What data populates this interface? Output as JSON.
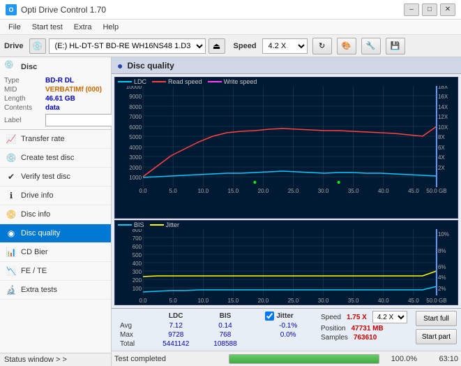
{
  "titleBar": {
    "title": "Opti Drive Control 1.70",
    "icon": "O",
    "minimizeLabel": "–",
    "maximizeLabel": "□",
    "closeLabel": "✕"
  },
  "menuBar": {
    "items": [
      "File",
      "Start test",
      "Extra",
      "Help"
    ]
  },
  "driveBar": {
    "driveLabel": "Drive",
    "driveValue": "(E:) HL-DT-ST BD-RE  WH16NS48 1.D3",
    "speedLabel": "Speed",
    "speedValue": "4.2 X"
  },
  "discSection": {
    "title": "Disc",
    "typeLabel": "Type",
    "typeValue": "BD-R DL",
    "midLabel": "MID",
    "midValue": "VERBATIMf (000)",
    "lengthLabel": "Length",
    "lengthValue": "46.61 GB",
    "contentsLabel": "Contents",
    "contentsValue": "data",
    "labelLabel": "Label"
  },
  "sidebarItems": [
    {
      "id": "transfer-rate",
      "label": "Transfer rate",
      "icon": "📈"
    },
    {
      "id": "create-test-disc",
      "label": "Create test disc",
      "icon": "💿"
    },
    {
      "id": "verify-test-disc",
      "label": "Verify test disc",
      "icon": "✅"
    },
    {
      "id": "drive-info",
      "label": "Drive info",
      "icon": "ℹ"
    },
    {
      "id": "disc-info",
      "label": "Disc info",
      "icon": "📀"
    },
    {
      "id": "disc-quality",
      "label": "Disc quality",
      "icon": "🔍",
      "active": true
    },
    {
      "id": "cd-bier",
      "label": "CD Bier",
      "icon": "📊"
    },
    {
      "id": "fe-te",
      "label": "FE / TE",
      "icon": "📉"
    },
    {
      "id": "extra-tests",
      "label": "Extra tests",
      "icon": "🔬"
    }
  ],
  "statusWindow": {
    "label": "Status window > >"
  },
  "discQuality": {
    "title": "Disc quality"
  },
  "topChart": {
    "legend": [
      {
        "label": "LDC",
        "color": "#00ccff"
      },
      {
        "label": "Read speed",
        "color": "#ff4444"
      },
      {
        "label": "Write speed",
        "color": "#ff44ff"
      }
    ],
    "yMax": 10000,
    "yMin": 0,
    "yLabels": [
      "10000",
      "9000",
      "8000",
      "7000",
      "6000",
      "5000",
      "4000",
      "3000",
      "2000",
      "1000"
    ],
    "yRightLabels": [
      "18X",
      "16X",
      "14X",
      "12X",
      "10X",
      "8X",
      "6X",
      "4X",
      "2X"
    ],
    "xLabels": [
      "0.0",
      "5.0",
      "10.0",
      "15.0",
      "20.0",
      "25.0",
      "30.0",
      "35.0",
      "40.0",
      "45.0",
      "50.0 GB"
    ]
  },
  "bottomChart": {
    "legend": [
      {
        "label": "BIS",
        "color": "#00ccff"
      },
      {
        "label": "Jitter",
        "color": "#ffff00"
      }
    ],
    "yMax": 800,
    "yLabels": [
      "800",
      "700",
      "600",
      "500",
      "400",
      "300",
      "200",
      "100"
    ],
    "yRightLabels": [
      "10%",
      "8%",
      "6%",
      "4%",
      "2%"
    ],
    "xLabels": [
      "0.0",
      "5.0",
      "10.0",
      "15.0",
      "20.0",
      "25.0",
      "30.0",
      "35.0",
      "40.0",
      "45.0",
      "50.0 GB"
    ]
  },
  "stats": {
    "headers": [
      "LDC",
      "BIS",
      "",
      "Jitter"
    ],
    "rows": [
      {
        "label": "Avg",
        "ldc": "7.12",
        "bis": "0.14",
        "jitter": "-0.1%"
      },
      {
        "label": "Max",
        "ldc": "9728",
        "bis": "768",
        "jitter": "0.0%"
      },
      {
        "label": "Total",
        "ldc": "5441142",
        "bis": "108588",
        "jitter": ""
      }
    ],
    "speedLabel": "Speed",
    "speedValue": "1.75 X",
    "speedSelectValue": "4.2 X",
    "positionLabel": "Position",
    "positionValue": "47731 MB",
    "samplesLabel": "Samples",
    "samplesValue": "763610",
    "startFullLabel": "Start full",
    "startPartLabel": "Start part",
    "jitterChecked": true,
    "jitterLabel": "Jitter"
  },
  "statusBottom": {
    "statusText": "Test completed",
    "progressValue": "100.0%",
    "samplesValue": "63:10"
  }
}
